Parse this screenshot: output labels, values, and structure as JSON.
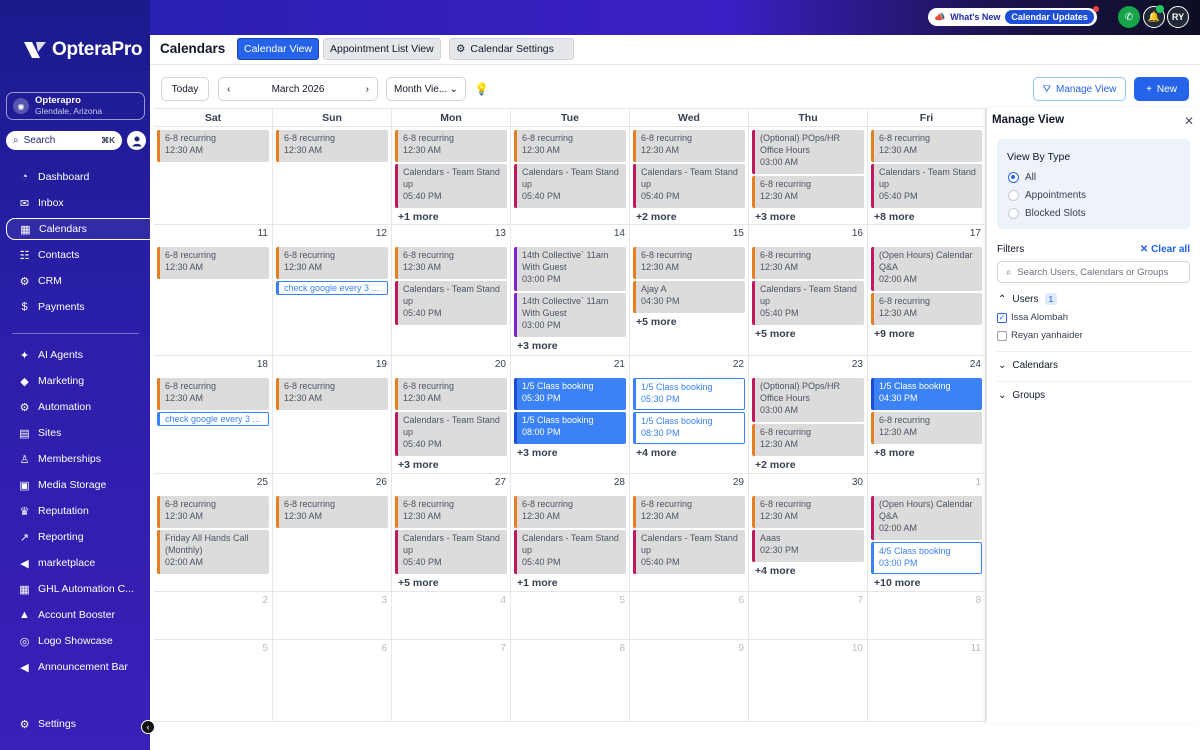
{
  "sidebar": {
    "logo": "OpteraPro",
    "location": {
      "name": "Opterapro",
      "sub": "Glendale, Arizona"
    },
    "search": {
      "label": "Search",
      "shortcut": "⌘K"
    },
    "items": [
      {
        "label": "Dashboard",
        "icon": "dashboard-icon",
        "glyph": "◔"
      },
      {
        "label": "Inbox",
        "icon": "inbox-icon",
        "glyph": "✉"
      },
      {
        "label": "Calendars",
        "icon": "calendar-icon",
        "glyph": "▦"
      },
      {
        "label": "Contacts",
        "icon": "contacts-icon",
        "glyph": "☷"
      },
      {
        "label": "CRM",
        "icon": "crm-icon",
        "glyph": "⚙"
      },
      {
        "label": "Payments",
        "icon": "payments-icon",
        "glyph": "$"
      },
      {
        "label": "AI Agents",
        "icon": "ai-agents-icon",
        "glyph": "✦"
      },
      {
        "label": "Marketing",
        "icon": "marketing-icon",
        "glyph": "◆"
      },
      {
        "label": "Automation",
        "icon": "automation-icon",
        "glyph": "⚙"
      },
      {
        "label": "Sites",
        "icon": "sites-icon",
        "glyph": "▤"
      },
      {
        "label": "Memberships",
        "icon": "memberships-icon",
        "glyph": "♙"
      },
      {
        "label": "Media Storage",
        "icon": "media-storage-icon",
        "glyph": "▣"
      },
      {
        "label": "Reputation",
        "icon": "reputation-icon",
        "glyph": "♛"
      },
      {
        "label": "Reporting",
        "icon": "reporting-icon",
        "glyph": "↗"
      },
      {
        "label": "marketplace",
        "icon": "marketplace-icon",
        "glyph": "◀"
      },
      {
        "label": "GHL Automation C...",
        "icon": "grid-icon",
        "glyph": "▦"
      },
      {
        "label": "Account Booster",
        "icon": "booster-icon",
        "glyph": "▲"
      },
      {
        "label": "Logo Showcase",
        "icon": "logo-showcase-icon",
        "glyph": "◎"
      },
      {
        "label": "Announcement Bar",
        "icon": "announcement-icon",
        "glyph": "◀"
      }
    ],
    "settings": {
      "label": "Settings",
      "icon": "settings-icon",
      "glyph": "⚙"
    }
  },
  "topbar": {
    "whats_new": "What's New",
    "updates": "Calendar Updates",
    "user_initials": "RY"
  },
  "header": {
    "title": "Calendars",
    "tabs": [
      "Calendar View",
      "Appointment List View",
      "Calendar Settings"
    ]
  },
  "toolbar": {
    "today": "Today",
    "month": "March 2026",
    "view": "Month Vie...",
    "manage_view": "Manage View",
    "new": "New"
  },
  "calendar": {
    "days_of_week": [
      "Sat",
      "Sun",
      "Mon",
      "Tue",
      "Wed",
      "Thu",
      "Fri"
    ],
    "weeks": [
      [
        {
          "day": "",
          "events": [
            {
              "title": "6-8 recurring",
              "time": "12:30 AM",
              "style": "orange"
            }
          ]
        },
        {
          "day": "",
          "events": [
            {
              "title": "6-8 recurring",
              "time": "12:30 AM",
              "style": "orange"
            }
          ]
        },
        {
          "day": "",
          "events": [
            {
              "title": "6-8 recurring",
              "time": "12:30 AM",
              "style": "orange"
            },
            {
              "title": "Calendars - Team Stand up",
              "time": "05:40 PM",
              "style": "pink"
            }
          ],
          "more": "+1 more"
        },
        {
          "day": "",
          "events": [
            {
              "title": "6-8 recurring",
              "time": "12:30 AM",
              "style": "orange"
            },
            {
              "title": "Calendars - Team Stand up",
              "time": "05:40 PM",
              "style": "pink"
            }
          ],
          "more": ""
        },
        {
          "day": "",
          "events": [
            {
              "title": "6-8 recurring",
              "time": "12:30 AM",
              "style": "orange"
            },
            {
              "title": "Calendars - Team Stand up",
              "time": "05:40 PM",
              "style": "pink"
            }
          ],
          "more": "+2 more"
        },
        {
          "day": "",
          "events": [
            {
              "title": "(Optional) POps/HR Office Hours",
              "time": "03:00 AM",
              "style": "pink"
            },
            {
              "title": "6-8 recurring",
              "time": "12:30 AM",
              "style": "orange"
            }
          ],
          "more": "+3 more"
        },
        {
          "day": "",
          "events": [
            {
              "title": "6-8 recurring",
              "time": "12:30 AM",
              "style": "orange"
            },
            {
              "title": "Calendars - Team Stand up",
              "time": "05:40 PM",
              "style": "pink"
            }
          ],
          "more": "+8 more"
        }
      ],
      [
        {
          "day": "11",
          "events": [
            {
              "title": "6-8 recurring",
              "time": "12:30 AM",
              "style": "orange"
            }
          ]
        },
        {
          "day": "12",
          "events": [
            {
              "title": "6-8 recurring",
              "time": "12:30 AM",
              "style": "orange"
            },
            {
              "title": "check google every 3 ...",
              "time": "",
              "style": "outline-sm"
            }
          ]
        },
        {
          "day": "13",
          "events": [
            {
              "title": "6-8 recurring",
              "time": "12:30 AM",
              "style": "orange"
            },
            {
              "title": "Calendars - Team Stand up",
              "time": "05:40 PM",
              "style": "pink"
            }
          ]
        },
        {
          "day": "14",
          "events": [
            {
              "title": "14th Collective` 11am With Guest",
              "time": "03:00 PM",
              "style": "purple"
            },
            {
              "title": "14th Collective` 11am With Guest",
              "time": "03:00 PM",
              "style": "purple"
            }
          ],
          "more": "+3 more"
        },
        {
          "day": "15",
          "events": [
            {
              "title": "6-8 recurring",
              "time": "12:30 AM",
              "style": "orange"
            },
            {
              "title": "Ajay A",
              "time": "04:30 PM",
              "style": "orange"
            }
          ],
          "more": "+5 more"
        },
        {
          "day": "16",
          "events": [
            {
              "title": "6-8 recurring",
              "time": "12:30 AM",
              "style": "orange"
            },
            {
              "title": "Calendars - Team Stand up",
              "time": "05:40 PM",
              "style": "pink"
            }
          ],
          "more": "+5 more"
        },
        {
          "day": "17",
          "events": [
            {
              "title": "(Open Hours) Calendar Q&A",
              "time": "02:00 AM",
              "style": "pink"
            },
            {
              "title": "6-8 recurring",
              "time": "12:30 AM",
              "style": "orange"
            }
          ],
          "more": "+9 more"
        }
      ],
      [
        {
          "day": "18",
          "events": [
            {
              "title": "6-8 recurring",
              "time": "12:30 AM",
              "style": "orange"
            },
            {
              "title": "check google every 3 ...",
              "time": "",
              "style": "outline-sm"
            }
          ]
        },
        {
          "day": "19",
          "events": [
            {
              "title": "6-8 recurring",
              "time": "12:30 AM",
              "style": "orange"
            }
          ]
        },
        {
          "day": "20",
          "events": [
            {
              "title": "6-8 recurring",
              "time": "12:30 AM",
              "style": "orange"
            },
            {
              "title": "Calendars - Team Stand up",
              "time": "05:40 PM",
              "style": "pink"
            }
          ],
          "more": "+3 more"
        },
        {
          "day": "21",
          "events": [
            {
              "title": "1/5  Class booking",
              "time": "05:30 PM",
              "style": "blue"
            },
            {
              "title": "1/5  Class booking",
              "time": "08:00 PM",
              "style": "blue"
            }
          ],
          "more": "+3 more"
        },
        {
          "day": "22",
          "events": [
            {
              "title": "1/5  Class booking",
              "time": "05:30 PM",
              "style": "outline"
            },
            {
              "title": "1/5  Class booking",
              "time": "08:30 PM",
              "style": "outline"
            }
          ],
          "more": "+4 more"
        },
        {
          "day": "23",
          "events": [
            {
              "title": "(Optional) POps/HR Office Hours",
              "time": "03:00 AM",
              "style": "pink"
            },
            {
              "title": "6-8 recurring",
              "time": "12:30 AM",
              "style": "orange"
            }
          ],
          "more": "+2 more"
        },
        {
          "day": "24",
          "events": [
            {
              "title": "1/5  Class booking",
              "time": "04:30 PM",
              "style": "blue"
            },
            {
              "title": "6-8 recurring",
              "time": "12:30 AM",
              "style": "orange"
            }
          ],
          "more": "+8 more"
        }
      ],
      [
        {
          "day": "25",
          "events": [
            {
              "title": "6-8 recurring",
              "time": "12:30 AM",
              "style": "orange"
            },
            {
              "title": "Friday All Hands Call (Monthly)",
              "time": "02:00 AM",
              "style": "orange"
            }
          ]
        },
        {
          "day": "26",
          "events": [
            {
              "title": "6-8 recurring",
              "time": "12:30 AM",
              "style": "orange"
            }
          ]
        },
        {
          "day": "27",
          "events": [
            {
              "title": "6-8 recurring",
              "time": "12:30 AM",
              "style": "orange"
            },
            {
              "title": "Calendars - Team Stand up",
              "time": "05:40 PM",
              "style": "pink"
            }
          ],
          "more": "+5 more"
        },
        {
          "day": "28",
          "events": [
            {
              "title": "6-8 recurring",
              "time": "12:30 AM",
              "style": "orange"
            },
            {
              "title": "Calendars - Team Stand up",
              "time": "05:40 PM",
              "style": "pink"
            }
          ],
          "more": "+1 more"
        },
        {
          "day": "29",
          "events": [
            {
              "title": "6-8 recurring",
              "time": "12:30 AM",
              "style": "orange"
            },
            {
              "title": "Calendars - Team Stand up",
              "time": "05:40 PM",
              "style": "pink"
            }
          ],
          "more": ""
        },
        {
          "day": "30",
          "events": [
            {
              "title": "6-8 recurring",
              "time": "12:30 AM",
              "style": "orange"
            },
            {
              "title": "Aaas",
              "time": "02:30 PM",
              "style": "pink"
            }
          ],
          "more": "+4 more"
        },
        {
          "day": "1",
          "muted": true,
          "events": [
            {
              "title": "(Open Hours) Calendar Q&A",
              "time": "02:00 AM",
              "style": "pink"
            },
            {
              "title": "4/5  Class booking",
              "time": "03:00 PM",
              "style": "outline"
            }
          ],
          "more": "+10 more"
        }
      ],
      [
        {
          "day": "2",
          "muted": true,
          "events": []
        },
        {
          "day": "3",
          "muted": true,
          "events": []
        },
        {
          "day": "4",
          "muted": true,
          "events": []
        },
        {
          "day": "5",
          "muted": true,
          "events": []
        },
        {
          "day": "6",
          "muted": true,
          "events": []
        },
        {
          "day": "7",
          "muted": true,
          "events": []
        },
        {
          "day": "8",
          "muted": true,
          "events": []
        }
      ],
      [
        {
          "day": "5",
          "muted": true,
          "events": []
        },
        {
          "day": "6",
          "muted": true,
          "events": []
        },
        {
          "day": "7",
          "muted": true,
          "events": []
        },
        {
          "day": "8",
          "muted": true,
          "events": []
        },
        {
          "day": "9",
          "muted": true,
          "events": []
        },
        {
          "day": "10",
          "muted": true,
          "events": []
        },
        {
          "day": "11",
          "muted": true,
          "events": []
        }
      ]
    ]
  },
  "panel": {
    "title": "Manage View",
    "view_by_type": {
      "title": "View By Type",
      "options": [
        "All",
        "Appointments",
        "Blocked Slots"
      ],
      "selected": "All"
    },
    "filters": {
      "title": "Filters",
      "clear_all": "Clear all",
      "search_placeholder": "Search Users, Calendars or Groups",
      "users_label": "Users",
      "users_count": "1",
      "users": [
        {
          "name": "Issa Alombah",
          "checked": true
        },
        {
          "name": "Reyan yanhaider",
          "checked": false
        }
      ],
      "calendars_label": "Calendars",
      "groups_label": "Groups"
    }
  }
}
